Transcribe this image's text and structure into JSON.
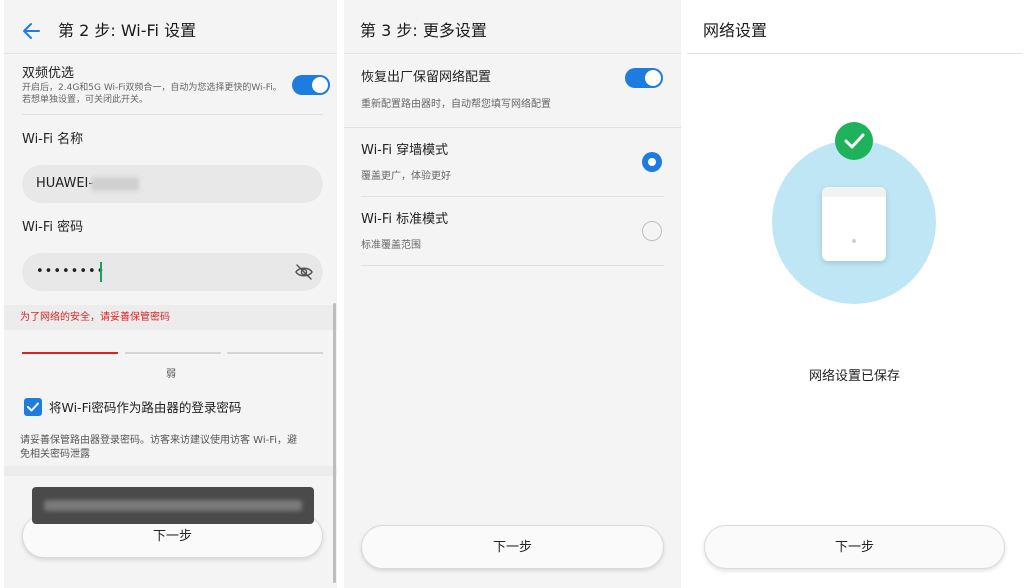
{
  "step2": {
    "title": "第 2 步: Wi-Fi 设置",
    "dual_band": {
      "label": "双频优选",
      "desc_line1": "开启后，2.4G和5G Wi-Fi双频合一，自动为您选择更快的Wi-Fi。",
      "desc_line2": "若想单独设置，可关闭此开关。",
      "enabled": true
    },
    "wifi_name_label": "Wi-Fi 名称",
    "wifi_name_value": "HUAWEI-",
    "wifi_password_label": "Wi-Fi 密码",
    "wifi_password_value": "••••••••",
    "security_warning": "为了网络的安全，请妥善保管密码",
    "strength_text": "弱",
    "checkbox_label": "将Wi-Fi密码作为路由器的登录密码",
    "checkbox_checked": true,
    "note_line1": "请妥善保管路由器登录密码。访客来访建议使用访客 Wi-Fi，避",
    "note_line2": "免相关密码泄露",
    "next_button": "下一步"
  },
  "step3": {
    "title": "第 3 步: 更多设置",
    "restore": {
      "label": "恢复出厂保留网络配置",
      "desc": "重新配置路由器时，自动帮您填写网络配置",
      "enabled": true
    },
    "modes": [
      {
        "label": "Wi-Fi 穿墙模式",
        "desc": "覆盖更广，体验更好",
        "selected": true
      },
      {
        "label": "Wi-Fi 标准模式",
        "desc": "标准覆盖范围",
        "selected": false
      }
    ],
    "next_button": "下一步"
  },
  "network": {
    "title": "网络设置",
    "saved_text": "网络设置已保存",
    "next_button": "下一步"
  },
  "colors": {
    "accent": "#1e7be0",
    "warning_red": "#e02020",
    "success_green": "#1fb25a",
    "circle_blue": "#bfe6f5"
  }
}
